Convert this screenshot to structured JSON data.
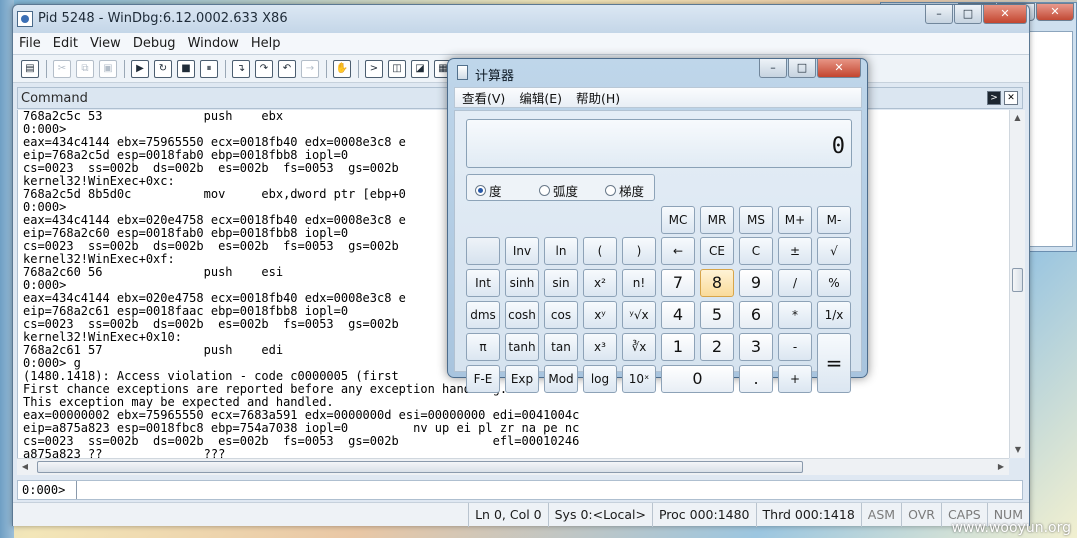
{
  "windbg": {
    "title": "Pid 5248 - WinDbg:6.12.0002.633 X86",
    "menu": [
      "File",
      "Edit",
      "View",
      "Debug",
      "Window",
      "Help"
    ],
    "command_pane_title": "Command",
    "output_lines": [
      "768a2c5c 53              push    ebx",
      "0:000>",
      "eax=434c4144 ebx=75965550 ecx=0018fb40 edx=0008e3c8 e",
      "eip=768a2c5d esp=0018fab0 ebp=0018fbb8 iopl=0",
      "cs=0023  ss=002b  ds=002b  es=002b  fs=0053  gs=002b",
      "kernel32!WinExec+0xc:",
      "768a2c5d 8b5d0c          mov     ebx,dword ptr [ebp+0",
      "0:000>",
      "eax=434c4144 ebx=020e4758 ecx=0018fb40 edx=0008e3c8 e",
      "eip=768a2c60 esp=0018fab0 ebp=0018fbb8 iopl=0",
      "cs=0023  ss=002b  ds=002b  es=002b  fs=0053  gs=002b",
      "kernel32!WinExec+0xf:",
      "768a2c60 56              push    esi",
      "0:000>",
      "eax=434c4144 ebx=020e4758 ecx=0018fb40 edx=0008e3c8 e",
      "eip=768a2c61 esp=0018faac ebp=0018fbb8 iopl=0",
      "cs=0023  ss=002b  ds=002b  es=002b  fs=0053  gs=002b",
      "kernel32!WinExec+0x10:",
      "768a2c61 57              push    edi",
      "0:000> g",
      "(1480.1418): Access violation - code c0000005 (first",
      "First chance exceptions are reported before any exception handling.",
      "This exception may be expected and handled.",
      "eax=00000002 ebx=75965550 ecx=7683a591 edx=0000000d esi=00000000 edi=0041004c",
      "eip=a875a823 esp=0018fbc8 ebp=754a7038 iopl=0         nv up ei pl zr na pe nc",
      "cs=0023  ss=002b  ds=002b  es=002b  fs=0053  gs=002b             efl=00010246",
      "a875a823 ??              ???"
    ],
    "prompt": "0:000>",
    "status": [
      "Ln 0, Col 0",
      "Sys 0:<Local>",
      "Proc 000:1480",
      "Thrd 000:1418",
      "ASM",
      "OVR",
      "CAPS",
      "NUM"
    ]
  },
  "calculator": {
    "title": "计算器",
    "menu": [
      "查看(V)",
      "编辑(E)",
      "帮助(H)"
    ],
    "display": "0",
    "angle_modes": [
      {
        "label": "度",
        "selected": true
      },
      {
        "label": "弧度",
        "selected": false
      },
      {
        "label": "梯度",
        "selected": false
      }
    ],
    "memory_keys": [
      "MC",
      "MR",
      "MS",
      "M+",
      "M-"
    ],
    "rows": [
      [
        "",
        "Inv",
        "ln",
        "(",
        ")",
        "←",
        "CE",
        "C",
        "±",
        "√"
      ],
      [
        "Int",
        "sinh",
        "sin",
        "x²",
        "n!",
        "7",
        "8",
        "9",
        "/",
        "%"
      ],
      [
        "dms",
        "cosh",
        "cos",
        "xʸ",
        "ʸ√x",
        "4",
        "5",
        "6",
        "*",
        "1/x"
      ],
      [
        "π",
        "tanh",
        "tan",
        "x³",
        "∛x",
        "1",
        "2",
        "3",
        "-",
        "="
      ],
      [
        "F-E",
        "Exp",
        "Mod",
        "log",
        "10ˣ",
        "0",
        ".",
        "+"
      ]
    ]
  },
  "watermark": "www.wooyun.org"
}
